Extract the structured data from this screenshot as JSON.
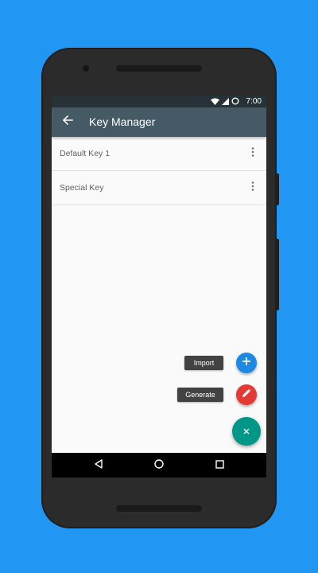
{
  "colors": {
    "background": "#2196f3",
    "status_bar": "#263238",
    "app_bar": "#455a64",
    "import_fab": "#1e88e5",
    "generate_fab": "#e53935",
    "main_fab": "#009688",
    "fab_label_bg": "#424242"
  },
  "status_bar": {
    "time": "7:00",
    "icons": [
      "wifi-icon",
      "cell-signal-icon",
      "battery-circle-icon"
    ]
  },
  "app_bar": {
    "back_icon": "arrow-back-icon",
    "title": "Key Manager"
  },
  "keys": [
    {
      "label": "Default Key 1",
      "menu_icon": "more-vert-icon"
    },
    {
      "label": "Special Key",
      "menu_icon": "more-vert-icon"
    }
  ],
  "fab_menu": {
    "import": {
      "label": "Import",
      "icon": "plus-icon"
    },
    "generate": {
      "label": "Generate",
      "icon": "pencil-icon"
    },
    "main": {
      "icon": "close-icon"
    }
  },
  "nav_bar": {
    "icons": [
      "nav-back-icon",
      "nav-home-icon",
      "nav-recents-icon"
    ]
  }
}
